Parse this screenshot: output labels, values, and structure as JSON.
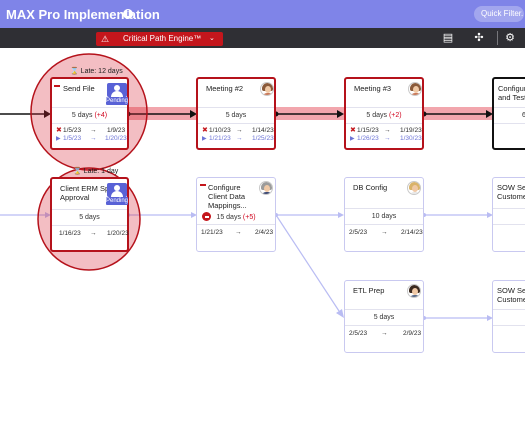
{
  "header": {
    "title": "MAX Pro Implementation",
    "info_icon": "info-icon",
    "quick_filter": "Quick Filter..."
  },
  "toolbar": {
    "critical_path_label": "Critical Path Engine™",
    "icons": [
      "gantt-view-icon",
      "link-tasks-icon",
      "settings-gear-icon"
    ]
  },
  "colors": {
    "header_bg": "#7f84e8",
    "toolbar_bg": "#2f2f34",
    "critical": "#b5121b",
    "critical_highlight": "#f2a6ad",
    "dependency_line": "#b9bcf3",
    "planned_text": "#6c73d6"
  },
  "lanes": {
    "critical_label_1": "Late: 12 days",
    "critical_label_2": "Late: 1 day"
  },
  "cards": {
    "send_file": {
      "title": "Send File",
      "duration": "5 days",
      "delta": "(+4)",
      "actual_start": "1/5/23",
      "actual_end": "1/9/23",
      "planned_start": "1/5/23",
      "planned_end": "1/20/23",
      "badge": "Pending"
    },
    "meeting2": {
      "title": "Meeting #2",
      "duration": "5 days",
      "delta": "",
      "actual_start": "1/10/23",
      "actual_end": "1/14/23",
      "planned_start": "1/21/23",
      "planned_end": "1/25/23"
    },
    "meeting3": {
      "title": "Meeting #3",
      "duration": "5 days",
      "delta": "(+2)",
      "actual_start": "1/15/23",
      "actual_end": "1/19/23",
      "planned_start": "1/26/23",
      "planned_end": "1/30/23"
    },
    "configure_testing": {
      "title_1": "Configure",
      "title_2": "and Testi",
      "duration": "6"
    },
    "client_erm": {
      "title_1": "Client ERM Spec",
      "title_2": "Approval",
      "duration": "5 days",
      "start": "1/16/23",
      "end": "1/20/23",
      "badge": "Pending"
    },
    "configure_client": {
      "title_1": "Configure",
      "title_2": "Client Data",
      "title_3": "Mappings...",
      "duration": "15 days",
      "delta": "(+5)",
      "start": "1/21/23",
      "end": "2/4/23"
    },
    "db_config": {
      "title": "DB Config",
      "duration": "10 days",
      "start": "2/5/23",
      "end": "2/14/23"
    },
    "sow_1": {
      "title_1": "SOW Sen",
      "title_2": "Custome"
    },
    "etl_prep": {
      "title": "ETL Prep",
      "duration": "5 days",
      "start": "2/5/23",
      "end": "2/9/23"
    },
    "sow_2": {
      "title_1": "SOW Sen",
      "title_2": "Custome"
    }
  },
  "arrow_glyph": "→",
  "status_marks": {
    "actual": "✖",
    "planned": "▶"
  }
}
